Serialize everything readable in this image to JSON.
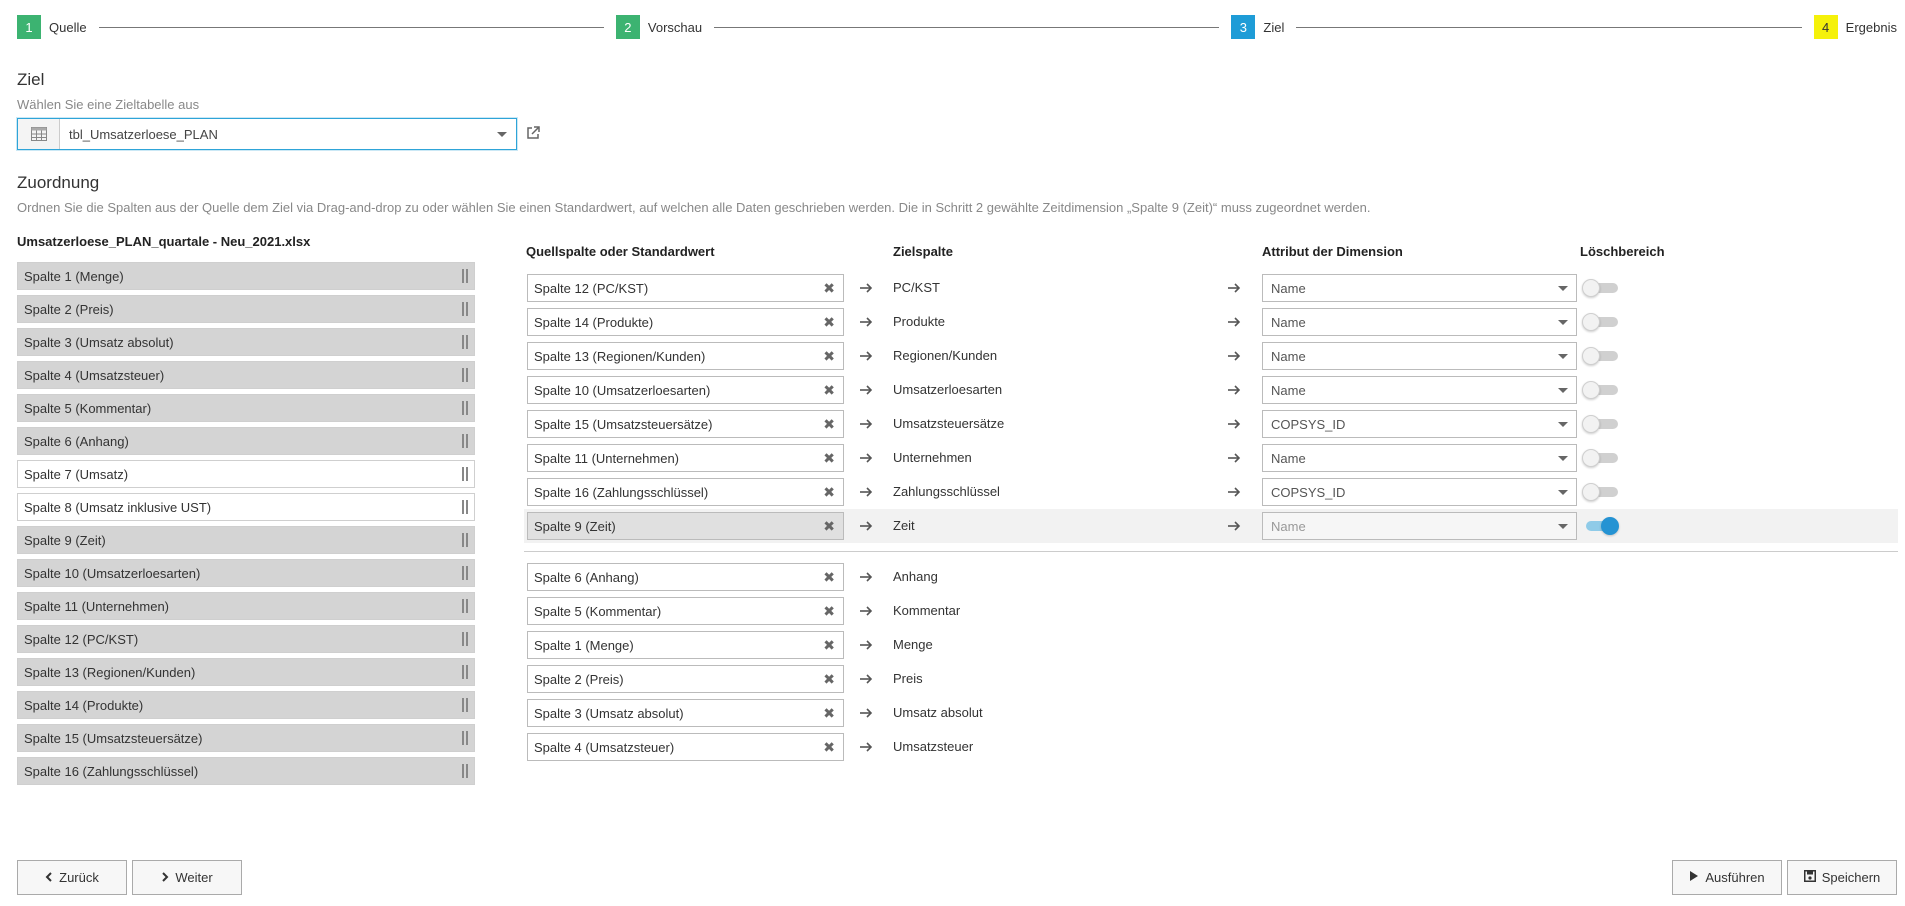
{
  "stepper": [
    {
      "num": "1",
      "label": "Quelle",
      "color": "#3cb371"
    },
    {
      "num": "2",
      "label": "Vorschau",
      "color": "#3cb371"
    },
    {
      "num": "3",
      "label": "Ziel",
      "color": "#1e9cd7"
    },
    {
      "num": "4",
      "label": "Ergebnis",
      "color": "#f5f10a"
    }
  ],
  "ziel": {
    "title": "Ziel",
    "subtitle": "Wählen Sie eine Zieltabelle aus",
    "selected_table": "tbl_Umsatzerloese_PLAN"
  },
  "zuordnung": {
    "title": "Zuordnung",
    "description": "Ordnen Sie die Spalten aus der Quelle dem Ziel via Drag-and-drop zu oder wählen Sie einen Standardwert, auf welchen alle Daten geschrieben werden. Die in Schritt 2 gewählte Zeitdimension „Spalte 9 (Zeit)“ muss zugeordnet werden."
  },
  "source": {
    "filename": "Umsatzerloese_PLAN_quartale - Neu_2021.xlsx",
    "columns": [
      {
        "label": "Spalte 1 (Menge)",
        "used": true
      },
      {
        "label": "Spalte 2 (Preis)",
        "used": true
      },
      {
        "label": "Spalte 3 (Umsatz absolut)",
        "used": true
      },
      {
        "label": "Spalte 4 (Umsatzsteuer)",
        "used": true
      },
      {
        "label": "Spalte 5 (Kommentar)",
        "used": true
      },
      {
        "label": "Spalte 6 (Anhang)",
        "used": true
      },
      {
        "label": "Spalte 7 (Umsatz)",
        "used": false
      },
      {
        "label": "Spalte 8 (Umsatz inklusive UST)",
        "used": false
      },
      {
        "label": "Spalte 9 (Zeit)",
        "used": true
      },
      {
        "label": "Spalte 10 (Umsatzerloesarten)",
        "used": true
      },
      {
        "label": "Spalte 11 (Unternehmen)",
        "used": true
      },
      {
        "label": "Spalte 12 (PC/KST)",
        "used": true
      },
      {
        "label": "Spalte 13 (Regionen/Kunden)",
        "used": true
      },
      {
        "label": "Spalte 14 (Produkte)",
        "used": true
      },
      {
        "label": "Spalte 15 (Umsatzsteuersätze)",
        "used": true
      },
      {
        "label": "Spalte 16 (Zahlungsschlüssel)",
        "used": true
      }
    ]
  },
  "mapping": {
    "headers": {
      "source": "Quellspalte oder Standardwert",
      "target": "Zielspalte",
      "attribute": "Attribut der Dimension",
      "delete": "Löschbereich"
    },
    "dimension_rows": [
      {
        "source": "Spalte 12 (PC/KST)",
        "target": "PC/KST",
        "attribute": "Name",
        "delete": false,
        "highlight": false
      },
      {
        "source": "Spalte 14 (Produkte)",
        "target": "Produkte",
        "attribute": "Name",
        "delete": false,
        "highlight": false
      },
      {
        "source": "Spalte 13 (Regionen/Kunden)",
        "target": "Regionen/Kunden",
        "attribute": "Name",
        "delete": false,
        "highlight": false
      },
      {
        "source": "Spalte 10 (Umsatzerloesarten)",
        "target": "Umsatzerloesarten",
        "attribute": "Name",
        "delete": false,
        "highlight": false
      },
      {
        "source": "Spalte 15 (Umsatzsteuersätze)",
        "target": "Umsatzsteuersätze",
        "attribute": "COPSYS_ID",
        "delete": false,
        "highlight": false
      },
      {
        "source": "Spalte 11 (Unternehmen)",
        "target": "Unternehmen",
        "attribute": "Name",
        "delete": false,
        "highlight": false
      },
      {
        "source": "Spalte 16 (Zahlungsschlüssel)",
        "target": "Zahlungsschlüssel",
        "attribute": "COPSYS_ID",
        "delete": false,
        "highlight": false
      },
      {
        "source": "Spalte 9 (Zeit)",
        "target": "Zeit",
        "attribute": "Name",
        "delete": true,
        "highlight": true
      }
    ],
    "value_rows": [
      {
        "source": "Spalte 6 (Anhang)",
        "target": "Anhang"
      },
      {
        "source": "Spalte 5 (Kommentar)",
        "target": "Kommentar"
      },
      {
        "source": "Spalte 1 (Menge)",
        "target": "Menge"
      },
      {
        "source": "Spalte 2 (Preis)",
        "target": "Preis"
      },
      {
        "source": "Spalte 3 (Umsatz absolut)",
        "target": "Umsatz absolut"
      },
      {
        "source": "Spalte 4 (Umsatzsteuer)",
        "target": "Umsatzsteuer"
      }
    ]
  },
  "footer": {
    "back": "Zurück",
    "next": "Weiter",
    "run": "Ausführen",
    "save": "Speichern"
  },
  "icons": {
    "table": "table-icon",
    "external": "external-link-icon",
    "arrow": "arrow-right-icon",
    "clear": "clear-icon",
    "drag": "drag-handle-icon",
    "back": "chevron-left-icon",
    "next": "chevron-right-icon",
    "run": "play-icon",
    "save": "floppy-disk-icon"
  }
}
